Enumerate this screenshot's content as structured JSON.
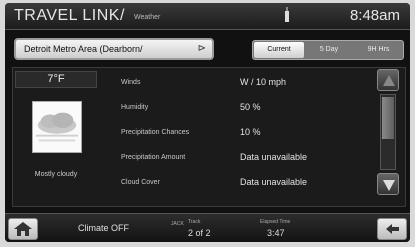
{
  "header": {
    "title": "TRAVEL LINK/",
    "subtitle": "Weather",
    "clock": "8:48am"
  },
  "location": {
    "label": "Detroit Metro Area (Dearborn/",
    "chevron": "⊳"
  },
  "tabs": [
    {
      "label": "Current",
      "active": true
    },
    {
      "label": "5 Day",
      "active": false
    },
    {
      "label": "9H Hrs",
      "active": false
    }
  ],
  "current": {
    "temperature": "7°F",
    "condition": "Mostly cloudy"
  },
  "details": [
    {
      "label": "Winds",
      "value": "W / 10 mph"
    },
    {
      "label": "Humidity",
      "value": "50 %"
    },
    {
      "label": "Precipitation Chances",
      "value": "10 %"
    },
    {
      "label": "Precipitation Amount",
      "value": "Data unavailable"
    },
    {
      "label": "Cloud Cover",
      "value": "Data unavailable"
    }
  ],
  "footer": {
    "climate": "Climate OFF",
    "jack_label": "JACK",
    "track_label": "Track",
    "track_value": "2 of 2",
    "elapsed_label": "Elapsed Time",
    "elapsed_value": "3:47"
  },
  "colors": {
    "background": "#111111",
    "button_face": "#e6e6e6"
  }
}
